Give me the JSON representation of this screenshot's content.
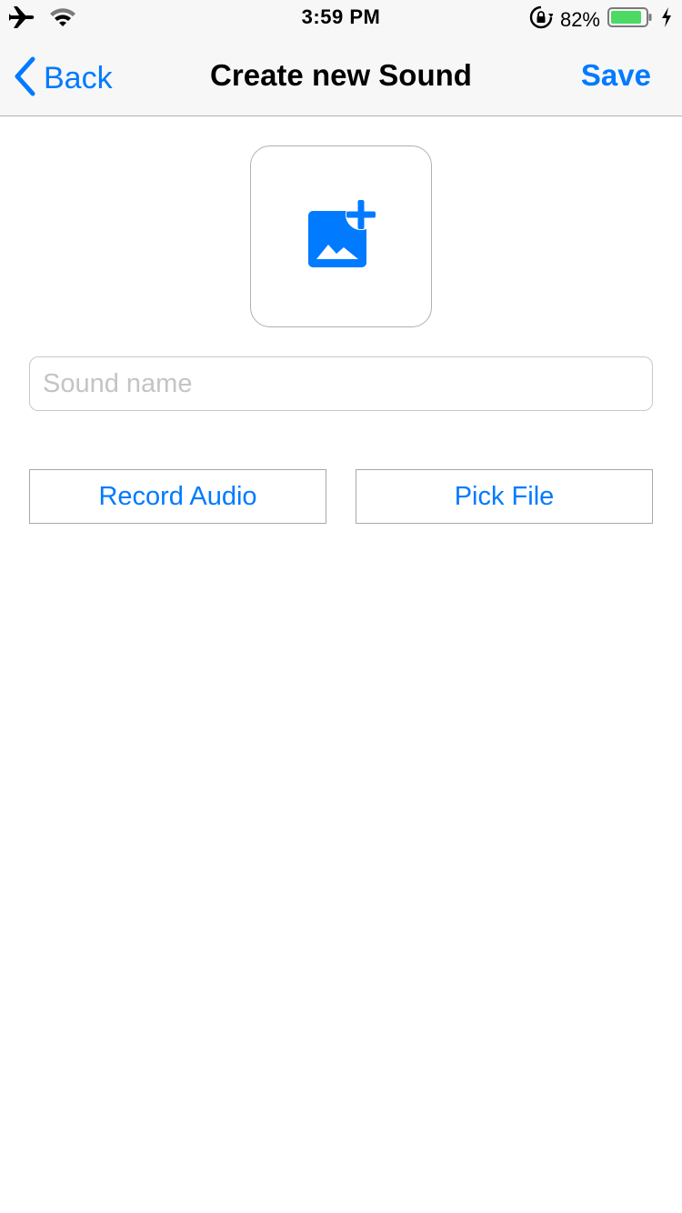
{
  "status_bar": {
    "time": "3:59 PM",
    "battery_percent": "82%",
    "icons": [
      "airplane-icon",
      "wifi-icon",
      "orientation-lock-icon",
      "battery-icon",
      "charging-bolt-icon"
    ]
  },
  "nav": {
    "back_label": "Back",
    "title": "Create new Sound",
    "save_label": "Save"
  },
  "image_picker": {
    "icon": "add-photo-icon"
  },
  "form": {
    "name_placeholder": "Sound name",
    "name_value": ""
  },
  "actions": {
    "record_label": "Record Audio",
    "pick_label": "Pick File"
  },
  "colors": {
    "accent": "#007aff",
    "battery_fill": "#4cd964",
    "bar_background": "#f7f7f7"
  }
}
